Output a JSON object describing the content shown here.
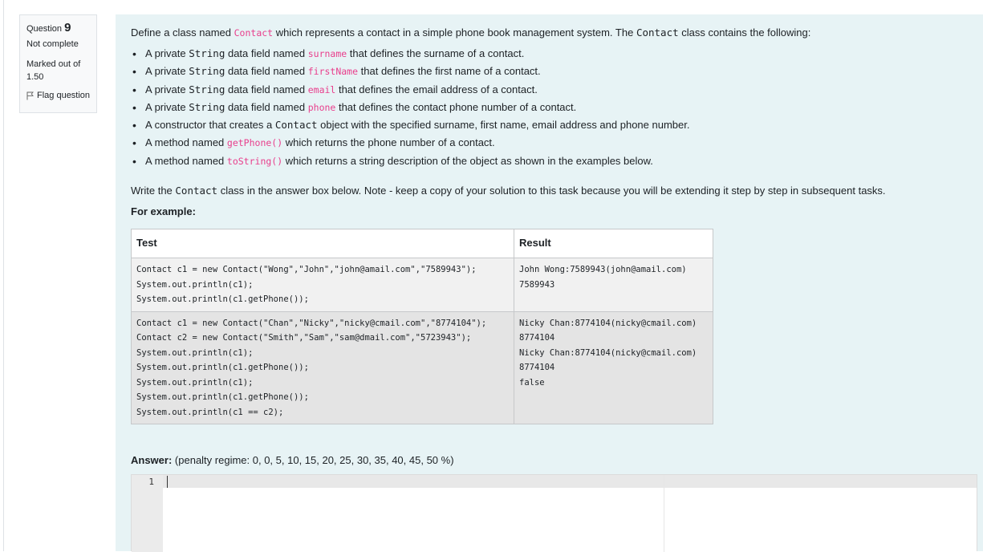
{
  "question_info": {
    "label": "Question",
    "number": "9",
    "state": "Not complete",
    "grade": "Marked out of 1.50",
    "flag_label": "Flag question"
  },
  "prompt": {
    "intro": {
      "before": "Define a class named ",
      "class_code": "Contact",
      "middle": " which represents a contact in a simple phone book management system. The ",
      "class_tt": "Contact",
      "after": " class contains the following:"
    },
    "items": [
      {
        "a": "A private ",
        "tt": "String",
        "b": " data field named ",
        "code": "surname",
        "c": " that defines the surname of a contact."
      },
      {
        "a": "A private ",
        "tt": "String",
        "b": " data field named ",
        "code": "firstName",
        "c": " that defines the first name of a contact."
      },
      {
        "a": "A private ",
        "tt": "String",
        "b": " data field named ",
        "code": "email",
        "c": " that defines the email address of a contact."
      },
      {
        "a": "A private ",
        "tt": "String",
        "b": " data field named ",
        "code": "phone",
        "c": " that defines the contact phone number of a contact."
      },
      {
        "a": "A constructor that creates a ",
        "tt": "Contact",
        "b": " object with the specified surname, first name, email address and phone number.",
        "code": "",
        "c": ""
      },
      {
        "a": "A method named ",
        "tt": "",
        "b": "",
        "code": "getPhone()",
        "c": " which returns the phone number of a contact."
      },
      {
        "a": "A method named ",
        "tt": "",
        "b": "",
        "code": "toString()",
        "c": " which returns a string description of the object as shown in the examples below."
      }
    ],
    "write": {
      "before": "Write the ",
      "tt": "Contact",
      "after": " class in the answer box below. Note - keep a copy of your solution to this task because you will be extending it step by step in subsequent tasks."
    },
    "for_example": "For example:"
  },
  "table": {
    "headers": [
      "Test",
      "Result"
    ],
    "rows": [
      {
        "test": [
          "Contact c1 = new Contact(\"Wong\",\"John\",\"john@amail.com\",\"7589943\");",
          "System.out.println(c1);",
          "System.out.println(c1.getPhone());"
        ],
        "result": [
          "John Wong:7589943(john@amail.com)",
          "7589943"
        ]
      },
      {
        "test": [
          "Contact c1 = new Contact(\"Chan\",\"Nicky\",\"nicky@cmail.com\",\"8774104\");",
          "Contact c2 = new Contact(\"Smith\",\"Sam\",\"sam@dmail.com\",\"5723943\");",
          "System.out.println(c1);",
          "System.out.println(c1.getPhone());",
          "System.out.println(c1);",
          "System.out.println(c1.getPhone());",
          "System.out.println(c1 == c2);"
        ],
        "result": [
          "Nicky Chan:8774104(nicky@cmail.com)",
          "8774104",
          "Nicky Chan:8774104(nicky@cmail.com)",
          "8774104",
          "false"
        ]
      }
    ]
  },
  "answer": {
    "label": "Answer:",
    "penalty": "(penalty regime: 0, 0, 5, 10, 15, 20, 25, 30, 35, 40, 45, 50 %)",
    "line_number": "1",
    "value": ""
  },
  "colors": {
    "panel_bg": "#e7f3f5",
    "code_pink": "#e83e8c",
    "row1_bg": "#f1f1f1",
    "row2_bg": "#e4e4e4"
  },
  "icons": {
    "flag": "flag-outline-icon"
  }
}
